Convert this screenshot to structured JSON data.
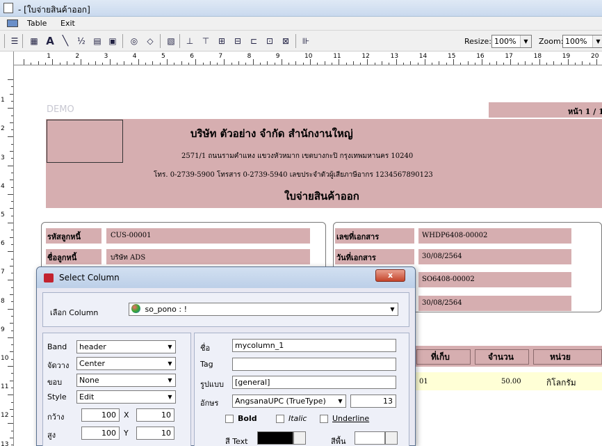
{
  "window": {
    "title": "- [ใบจ่ายสินค้าออก]"
  },
  "menu": [
    "Table",
    "Exit"
  ],
  "toolbar": {
    "resize_label": "Resize:",
    "resize_value": "100%",
    "zoom_label": "Zoom:",
    "zoom_value": "100%"
  },
  "ruler": {
    "top": [
      "1",
      "2",
      "3",
      "4",
      "5",
      "6",
      "7",
      "8",
      "9",
      "10",
      "11",
      "12",
      "13",
      "14",
      "15",
      "16",
      "17",
      "18",
      "19",
      "20"
    ],
    "left": [
      "1",
      "2",
      "3",
      "4",
      "5",
      "6",
      "7",
      "8",
      "9",
      "10",
      "11",
      "12",
      "13"
    ]
  },
  "report": {
    "demo": "DEMO",
    "page": "หน้า 1 / 1",
    "company": "บริษัท ตัวอย่าง จำกัด   สำนักงานใหญ่",
    "address": "2571/1 ถนนรามคำแหง แขวงหัวหมาก เขตบางกะปิ กรุงเทพมหานคร 10240",
    "contact": "โทร. 0-2739-5900  โทรสาร 0-2739-5940   เลขประจำตัวผู้เสียภาษีอากร 1234567890123",
    "doc_title": "ใบจ่ายสินค้าออก",
    "customer_code_label": "รหัสลูกหนี้",
    "customer_code": "CUS-00001",
    "customer_name_label": "ชื่อลูกหนี้",
    "customer_name": "บริษัท ADS",
    "doc_no_label": "เลขที่เอกสาร",
    "doc_no": "WHDP6408-00002",
    "doc_date_label": "วันที่เอกสาร",
    "doc_date": "30/08/2564",
    "so_no": "SO6408-00002",
    "so_date": "30/08/2564",
    "col_location": "ที่เก็บ",
    "col_qty": "จำนวน",
    "col_unit": "หน่วย",
    "row_location": "01",
    "row_qty": "50.00",
    "row_unit": "กิโลกรัม"
  },
  "dialog": {
    "title": "Select Column",
    "close": "x",
    "column_label": "เลือก Column",
    "column_value": "so_pono : !",
    "band_label": "Band",
    "band_value": "header",
    "align_label": "จัดวาง",
    "align_value": "Center",
    "border_label": "ขอบ",
    "border_value": "None",
    "style_label": "Style",
    "style_value": "Edit",
    "width_label": "กว้าง",
    "width_value": "100",
    "x_label": "X",
    "x_value": "10",
    "height_label": "สูง",
    "height_value": "100",
    "y_label": "Y",
    "y_value": "10",
    "name_label": "ชื่อ",
    "name_value": "mycolumn_1",
    "tag_label": "Tag",
    "tag_value": "",
    "format_label": "รูปแบบ",
    "format_value": "[general]",
    "font_label": "อักษร",
    "font_value": "AngsanaUPC (TrueType)",
    "font_size": "13",
    "bold_label": "Bold",
    "italic_label": "Italic",
    "underline_label": "Underline",
    "text_color_label": "สี Text",
    "bg_color_label": "สีพื้น"
  },
  "colors": {
    "report_band": "#d6aeb0",
    "row_highlight": "#ffffd6",
    "dialog_bg": "#e8e8f2"
  }
}
